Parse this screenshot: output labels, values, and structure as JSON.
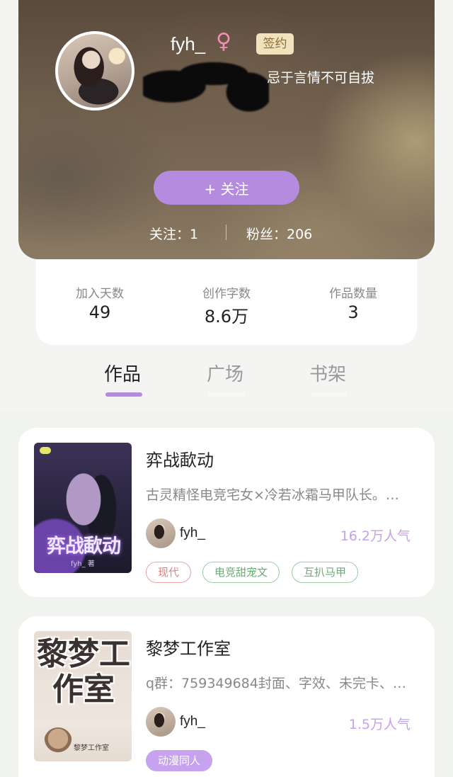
{
  "profile": {
    "username": "fyh_",
    "gender_icon": "female-icon",
    "gender_symbol": "♀",
    "sign_badge": "签约",
    "bio_visible": "忌于言情不可自拔",
    "follow_button": "+ 关注",
    "follow_label": "关注",
    "follow_count": "1",
    "following_text": "关注：1",
    "fans_text": "粉丝：206"
  },
  "stats": [
    {
      "label": "加入天数",
      "value": "49"
    },
    {
      "label": "创作字数",
      "value": "8.6万"
    },
    {
      "label": "作品数量",
      "value": "3"
    }
  ],
  "tabs": [
    {
      "label": "作品",
      "active": true
    },
    {
      "label": "广场",
      "active": false
    },
    {
      "label": "书架",
      "active": false
    }
  ],
  "works": [
    {
      "title": "弈战歃动",
      "description": "古灵精怪电竞宅女×冷若冰霜马甲队长。…",
      "author": "fyh_",
      "popularity": "16.2万人气",
      "cover_title": "弈战歃动",
      "cover_author": "fyh_ 著",
      "tags": [
        "现代",
        "电竞甜宠文",
        "互扒马甲"
      ]
    },
    {
      "title": "黎梦工作室",
      "description": "q群：759349684封面、字效、未完卡、…",
      "author": "fyh_",
      "popularity": "1.5万人气",
      "cover_title": "黎梦工作室",
      "cover_label": "黎梦工作室",
      "tags": [
        "动漫同人"
      ]
    }
  ],
  "colors": {
    "accent": "#b58be0",
    "popularity": "#c5a3ea",
    "sign_badge_bg": "#efe2bd",
    "tag_red": "#e28181",
    "tag_green": "#6aad73",
    "tag_purple_fill": "#c7a2ee"
  }
}
